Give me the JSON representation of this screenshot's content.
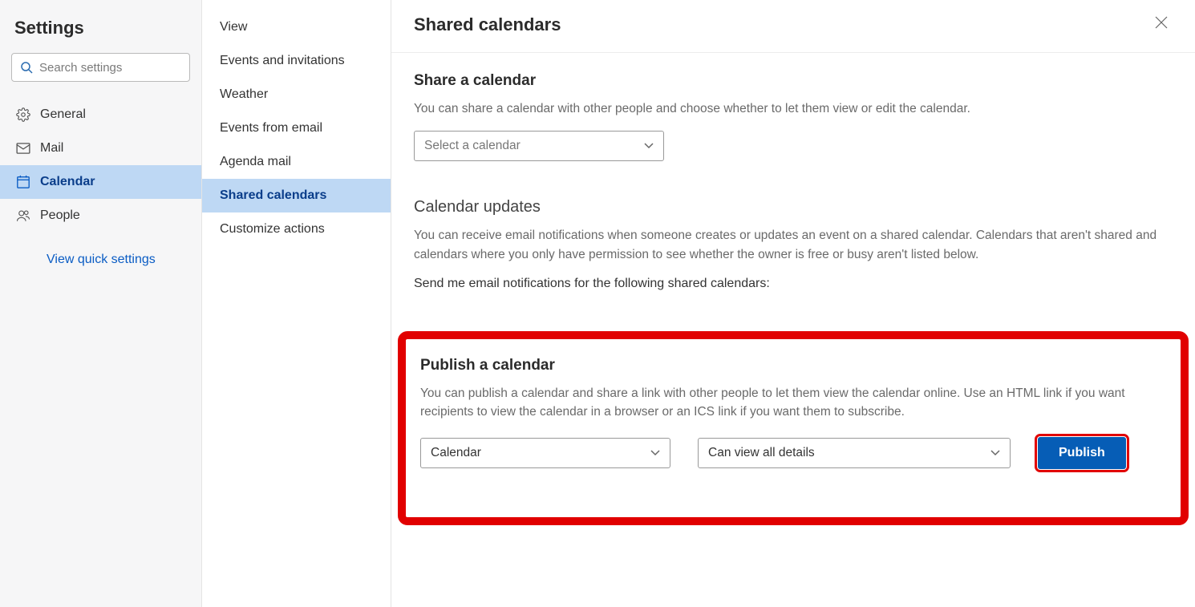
{
  "settings": {
    "title": "Settings",
    "search_placeholder": "Search settings",
    "nav": {
      "general": "General",
      "mail": "Mail",
      "calendar": "Calendar",
      "people": "People"
    },
    "quick_link": "View quick settings"
  },
  "subnav": {
    "view": "View",
    "events_invitations": "Events and invitations",
    "weather": "Weather",
    "events_from_email": "Events from email",
    "agenda_mail": "Agenda mail",
    "shared_calendars": "Shared calendars",
    "customize_actions": "Customize actions"
  },
  "page": {
    "title": "Shared calendars",
    "share": {
      "heading": "Share a calendar",
      "desc": "You can share a calendar with other people and choose whether to let them view or edit the calendar.",
      "select_placeholder": "Select a calendar"
    },
    "updates": {
      "heading": "Calendar updates",
      "desc": "You can receive email notifications when someone creates or updates an event on a shared calendar. Calendars that aren't shared and calendars where you only have permission to see whether the owner is free or busy aren't listed below.",
      "instruction": "Send me email notifications for the following shared calendars:"
    },
    "publish": {
      "heading": "Publish a calendar",
      "desc": "You can publish a calendar and share a link with other people to let them view the calendar online. Use an HTML link if you want recipients to view the calendar in a browser or an ICS link if you want them to subscribe.",
      "calendar_value": "Calendar",
      "permission_value": "Can view all details",
      "button": "Publish"
    }
  }
}
